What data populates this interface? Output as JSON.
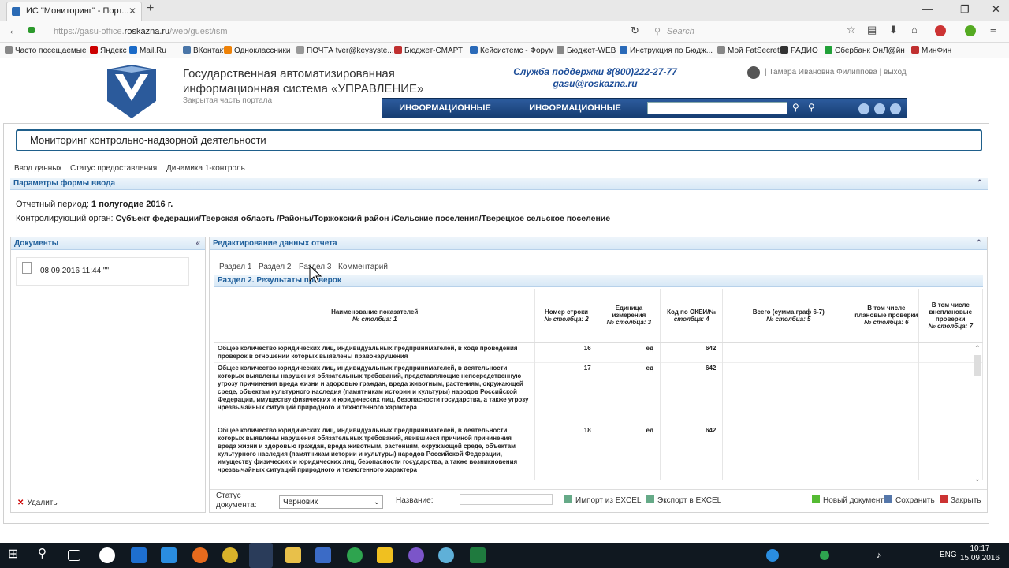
{
  "browser": {
    "tab_title": "ИС \"Мониторинг\" - Порт...",
    "url_prefix": "https://gasu-office.",
    "url_domain": "roskazna.ru",
    "url_path": "/web/guest/ism",
    "search_placeholder": "Search",
    "bookmarks": [
      {
        "label": "Часто посещаемые",
        "color": "#888888"
      },
      {
        "label": "Яндекс",
        "color": "#cc0000"
      },
      {
        "label": "Mail.Ru",
        "color": "#1b6bc8"
      },
      {
        "label": "ВКонтакте",
        "color": "#4a76a8"
      },
      {
        "label": "Одноклассники",
        "color": "#ee8208"
      },
      {
        "label": "ПОЧТА tver@keysyste...",
        "color": "#999999"
      },
      {
        "label": "Бюджет-СМАРТ",
        "color": "#c03030"
      },
      {
        "label": "Кейсистемс - Форум",
        "color": "#2a6ab8"
      },
      {
        "label": "Бюджет-WEB",
        "color": "#888888"
      },
      {
        "label": "Инструкция по Бюдж...",
        "color": "#2a6ab8"
      },
      {
        "label": "Мой FatSecret",
        "color": "#888888"
      },
      {
        "label": "РАДИО",
        "color": "#333333"
      },
      {
        "label": "Сбербанк ОнЛ@йн",
        "color": "#21a038"
      },
      {
        "label": "МинФин",
        "color": "#c03030"
      }
    ]
  },
  "portal": {
    "title_line1": "Государственная автоматизированная",
    "title_line2": "информационная система «УПРАВЛЕНИЕ»",
    "subtitle": "Закрытая часть портала",
    "support_label": "Служба поддержки 8(800)222-27-77",
    "support_email": "gasu@roskazna.ru",
    "user_info": "| Тамара Ивановна Филиппова | выход",
    "menu": [
      "ИНФОРМАЦИОННЫЕ ПАНЕЛИ",
      "ИНФОРМАЦИОННЫЕ СЕРВИСЫ"
    ]
  },
  "page": {
    "title": "Мониторинг контрольно-надзорной деятельности",
    "nav": [
      "Ввод данных",
      "Статус предоставления",
      "Динамика 1-контроль"
    ],
    "params_header": "Параметры формы ввода",
    "period_label": "Отчетный период:",
    "period_value": "1 полугодие 2016 г.",
    "organ_label": "Контролирующий орган:",
    "organ_value": "Субъект федерации/Тверская область /Районы/Торжокский район /Сельские поселения/Тверецкое сельское поселение"
  },
  "documents": {
    "header": "Документы",
    "items": [
      {
        "label": "08.09.2016 11:44 \"\""
      }
    ],
    "delete_label": "Удалить"
  },
  "editor": {
    "header": "Редактирование данных отчета",
    "subtabs": [
      "Раздел 1",
      "Раздел 2",
      "Раздел 3",
      "Комментарий"
    ],
    "section_title": "Раздел 2. Результаты проверок",
    "columns": [
      {
        "name": "Наименование показателей",
        "sub": "№ столбца: 1"
      },
      {
        "name": "Номер строки",
        "sub": "№ столбца: 2"
      },
      {
        "name": "Единица измерения",
        "sub": "№ столбца: 3"
      },
      {
        "name": "Код по ОКЕИ/№",
        "sub": "столбца: 4"
      },
      {
        "name": "Всего (сумма граф 6-7)",
        "sub": "№ столбца: 5"
      },
      {
        "name": "В том числе плановые проверки",
        "sub": "№ столбца: 6"
      },
      {
        "name": "В том числе внеплановые проверки",
        "sub": "№ столбца: 7"
      }
    ],
    "rows": [
      {
        "name": "Общее количество юридических лиц, индивидуальных предпринимателей, в ходе проведения проверок в отношении которых выявлены правонарушения",
        "num": "16",
        "unit": "ед",
        "okei": "642"
      },
      {
        "name": "Общее количество юридических лиц, индивидуальных предпринимателей, в деятельности которых выявлены нарушения обязательных требований, представляющие непосредственную угрозу причинения вреда жизни и здоровью граждан, вреда животным, растениям, окружающей среде, объектам культурного наследия (памятникам истории и культуры) народов Российской Федерации, имуществу физических и юридических лиц, безопасности государства, а также угрозу чрезвычайных ситуаций природного и техногенного характера",
        "num": "17",
        "unit": "ед",
        "okei": "642"
      },
      {
        "name": "Общее количество юридических лиц, индивидуальных предпринимателей, в деятельности которых выявлены нарушения обязательных требований, явившиеся причиной причинения вреда жизни и здоровью граждан, вреда животным, растениям, окружающей среде, объектам культурного наследия (памятникам истории и культуры) народов Российской Федерации, имуществу физических и юридических лиц, безопасности государства, а также возникновения чрезвычайных ситуаций природного и техногенного характера",
        "num": "18",
        "unit": "ед",
        "okei": "642"
      }
    ]
  },
  "bottom": {
    "status_label_1": "Статус",
    "status_label_2": "документа:",
    "status_value": "Черновик",
    "name_label": "Название:",
    "import_label": "Импорт из EXCEL",
    "export_label": "Экспорт в EXCEL",
    "new_doc_label": "Новый документ",
    "save_label": "Сохранить",
    "close_label": "Закрыть"
  },
  "taskbar": {
    "lang": "ENG",
    "time": "10:17",
    "date": "15.09.2016"
  }
}
